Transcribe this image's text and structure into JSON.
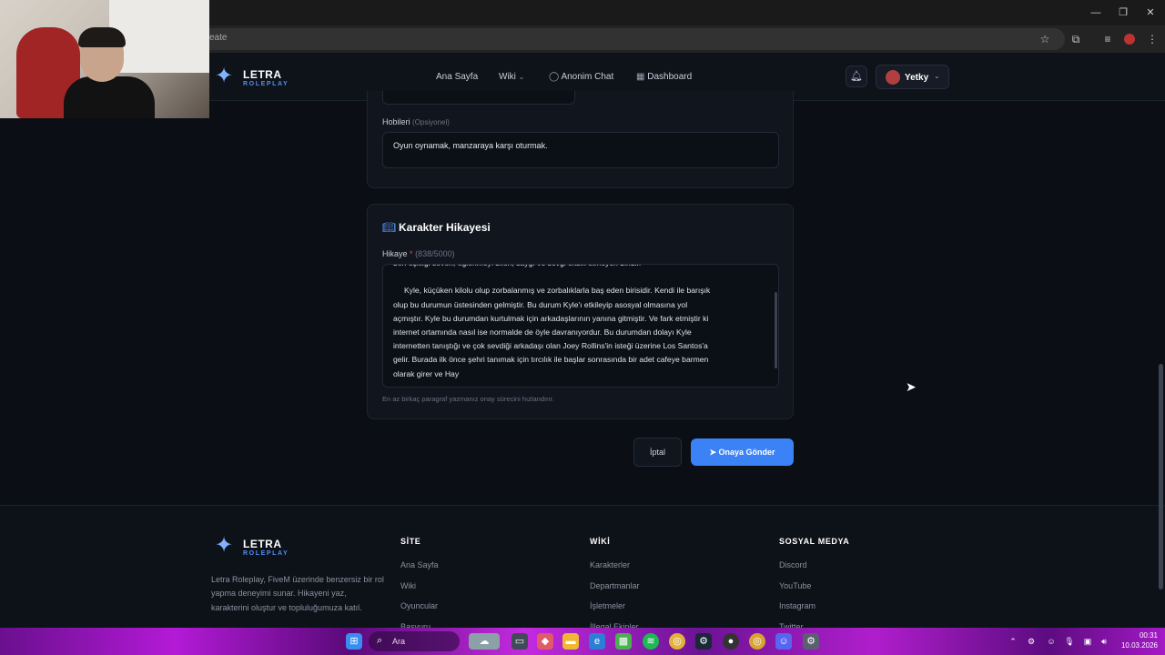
{
  "browser": {
    "url": "eate",
    "window_controls": [
      "—",
      "❐",
      "✕"
    ]
  },
  "header": {
    "logo_title": "LETRA",
    "logo_sub": "ROLEPLAY",
    "nav": {
      "home": "Ana Sayfa",
      "wiki": "Wiki",
      "chat": "Anonim Chat",
      "dashboard": "Dashboard"
    },
    "user": "Yetky"
  },
  "hobbies": {
    "label": "Hobileri",
    "optional": "(Opsiyonel)",
    "value": "Oyun oynamak, manzaraya karşı oturmak."
  },
  "story_card": {
    "title": "Karakter Hikayesi",
    "label": "Hikaye",
    "required": "*",
    "counter": "(838/5000)",
    "text": "ben eşitliği seven, eğlenmeyi bilen, saygı ve sevgi eksik etmeyen biridir.\n\n     Kyle, küçüken kilolu olup zorbalanmış ve zorbalıklarla baş eden birisidir. Kendi ile barışık\nolup bu durumun üstesinden gelmiştir. Bu durum Kyle'ı etkileyip asosyal olmasına yol\naçmıştır. Kyle bu durumdan kurtulmak için arkadaşlarının yanına gitmiştir. Ve fark etmiştir ki\ninternet ortamında nasıl ise normalde de öyle davranıyordur. Bu durumdan dolayı Kyle\ninternetten tanıştığı ve çok sevdiği arkadaşı olan Joey Rollins'in isteği üzerine Los Santos'a\ngelir. Burada ilk önce şehri tanımak için tırcılık ile başlar sonrasında bir adet cafeye barmen\nolarak girer ve Hay",
    "hint": "En az birkaç paragraf yazmanız onay sürecini hızlandırır."
  },
  "actions": {
    "cancel": "İptal",
    "submit": "Onaya Gönder"
  },
  "footer": {
    "logo_title": "LETRA",
    "logo_sub": "ROLEPLAY",
    "description": "Letra Roleplay, FiveM üzerinde benzersiz bir rol yapma deneyimi sunar. Hikayeni yaz, karakterini oluştur ve topluluğumuza katıl.",
    "site": {
      "heading": "SİTE",
      "links": [
        "Ana Sayfa",
        "Wiki",
        "Oyuncular",
        "Basvuru"
      ]
    },
    "wiki": {
      "heading": "WİKİ",
      "links": [
        "Karakterler",
        "Departmanlar",
        "İşletmeler",
        "İllegal Ekipler"
      ]
    },
    "social": {
      "heading": "SOSYAL MEDYA",
      "links": [
        "Discord",
        "YouTube",
        "Instagram",
        "Twitter"
      ]
    }
  },
  "taskbar": {
    "search_placeholder": "Ara",
    "time": "00:31",
    "date": "10.03.2026"
  }
}
